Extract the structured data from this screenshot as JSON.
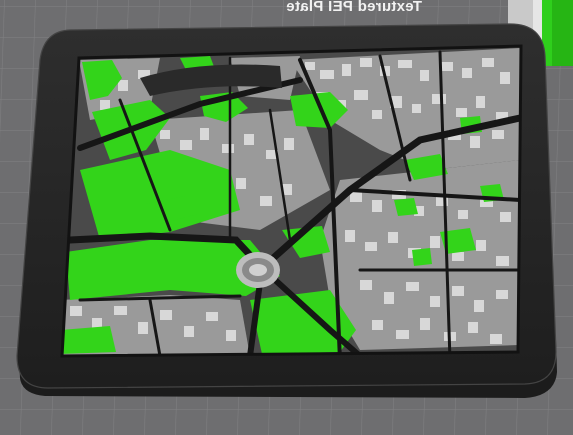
{
  "bed": {
    "label": "Textured PEI Plate",
    "surface_color": "#6e6e70",
    "grid_color": "#7c7c7e",
    "label_color": "#f2f2f2"
  },
  "model": {
    "base_color": "#262626",
    "border_top_color": "#3a3a3a",
    "rim_color": "#141414",
    "map_fill_color": "#4a4a4a",
    "building_color": "#9a9a9a",
    "building_highlight_color": "#dcdcdc",
    "park_color": "#33d41a",
    "road_color": "#161616",
    "landmark": "colosseum"
  },
  "side_object": {
    "colors": [
      "#e6e6e6",
      "#2fcf1c"
    ]
  }
}
